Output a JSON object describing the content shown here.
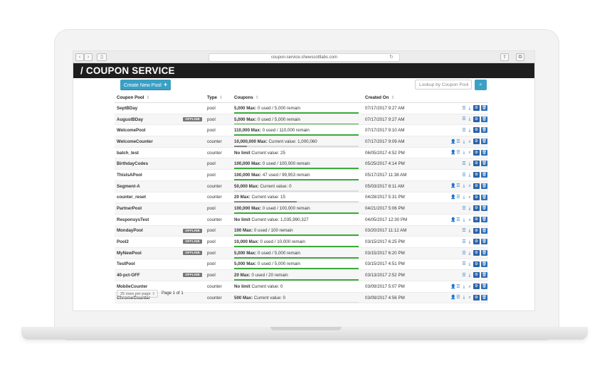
{
  "browser": {
    "url": "coupon-service.shewscottlabs.com",
    "back": "‹",
    "forward": "›",
    "sidebar_icon": "▯",
    "reload_icon": "↻",
    "share_icon": "⇧",
    "tabs_icon": "⧉"
  },
  "header": {
    "title": "/ COUPON SERVICE"
  },
  "toolbar": {
    "create_label": "Create New Pool",
    "create_icon": "+",
    "lookup_placeholder": "Lookup by Coupon Pool",
    "search_icon": "⌕"
  },
  "columns": {
    "name": "Coupon Pool",
    "type": "Type",
    "coupons": "Coupons",
    "created": "Created On",
    "sort_icon": "⇕"
  },
  "rows": [
    {
      "name": "SeptBDay",
      "badge": "",
      "type": "pool",
      "max": "5,000 Max:",
      "detail": "0 used / 5,000 remain",
      "progress": 1.0,
      "bar": "green",
      "created": "07/17/2017 9:27 AM",
      "user_icon": false
    },
    {
      "name": "AugustBDay",
      "badge": "OFFLINE",
      "type": "pool",
      "max": "5,000 Max:",
      "detail": "0 used / 5,000 remain",
      "progress": 1.0,
      "bar": "green",
      "created": "07/17/2017 9:27 AM",
      "user_icon": false
    },
    {
      "name": "WelcomePool",
      "badge": "",
      "type": "pool",
      "max": "110,000 Max:",
      "detail": "0 used / 110,000 remain",
      "progress": 1.0,
      "bar": "green",
      "created": "07/17/2017 9:10 AM",
      "user_icon": false
    },
    {
      "name": "WelcomeCounter",
      "badge": "",
      "type": "counter",
      "max": "10,000,000 Max:",
      "detail": "Current value: 1,000,060",
      "progress": 0.1,
      "bar": "dark",
      "created": "07/17/2017 9:09 AM",
      "user_icon": true
    },
    {
      "name": "batch_test",
      "badge": "",
      "type": "counter",
      "max": "No limit",
      "detail": "Current value: 25",
      "progress": null,
      "bar": "none",
      "created": "06/05/2017 4:52 PM",
      "user_icon": true
    },
    {
      "name": "BirthdayCodes",
      "badge": "",
      "type": "pool",
      "max": "100,000 Max:",
      "detail": "0 used / 100,000 remain",
      "progress": 1.0,
      "bar": "green",
      "created": "05/25/2017 4:14 PM",
      "user_icon": false
    },
    {
      "name": "ThisIsAPool",
      "badge": "",
      "type": "pool",
      "max": "100,000 Max:",
      "detail": "47 used / 99,953 remain",
      "progress": 1.0,
      "bar": "green",
      "created": "05/17/2017 11:38 AM",
      "user_icon": false
    },
    {
      "name": "Segment-A",
      "badge": "",
      "type": "counter",
      "max": "50,000 Max:",
      "detail": "Current value: 0",
      "progress": 0.0,
      "bar": "dark",
      "created": "05/03/2017 8:11 AM",
      "user_icon": true
    },
    {
      "name": "counter_reset",
      "badge": "",
      "type": "counter",
      "max": "20 Max:",
      "detail": "Current value: 15",
      "progress": 0.5,
      "bar": "dark",
      "created": "04/28/2017 5:31 PM",
      "user_icon": true
    },
    {
      "name": "PartnerPool",
      "badge": "",
      "type": "pool",
      "max": "100,000 Max:",
      "detail": "0 used / 100,000 remain",
      "progress": 1.0,
      "bar": "green",
      "created": "04/21/2017 5:06 PM",
      "user_icon": false
    },
    {
      "name": "ResponsysTest",
      "badge": "",
      "type": "counter",
      "max": "No limit",
      "detail": "Current value: 1,035,990,327",
      "progress": null,
      "bar": "none",
      "created": "04/05/2017 12:30 PM",
      "user_icon": true
    },
    {
      "name": "MondayPool",
      "badge": "OFFLINE",
      "type": "pool",
      "max": "100 Max:",
      "detail": "0 used / 100 remain",
      "progress": 1.0,
      "bar": "green",
      "created": "03/20/2017 11:12 AM",
      "user_icon": false
    },
    {
      "name": "Pool2",
      "badge": "OFFLINE",
      "type": "pool",
      "max": "10,000 Max:",
      "detail": "0 used / 10,000 remain",
      "progress": 1.0,
      "bar": "green",
      "created": "03/15/2017 6:25 PM",
      "user_icon": false
    },
    {
      "name": "MyNewPool",
      "badge": "OFFLINE",
      "type": "pool",
      "max": "5,000 Max:",
      "detail": "0 used / 5,000 remain",
      "progress": 1.0,
      "bar": "green",
      "created": "03/15/2017 6:20 PM",
      "user_icon": false
    },
    {
      "name": "TestPool",
      "badge": "",
      "type": "pool",
      "max": "5,000 Max:",
      "detail": "0 used / 5,000 remain",
      "progress": 1.0,
      "bar": "green",
      "created": "03/15/2017 4:51 PM",
      "user_icon": false
    },
    {
      "name": "40-pct-OFF",
      "badge": "OFFLINE",
      "type": "pool",
      "max": "20 Max:",
      "detail": "0 used / 20 remain",
      "progress": 1.0,
      "bar": "green",
      "created": "03/13/2017 2:52 PM",
      "user_icon": false
    },
    {
      "name": "MobileCounter",
      "badge": "",
      "type": "counter",
      "max": "No limit",
      "detail": "Current value: 0",
      "progress": null,
      "bar": "none",
      "created": "03/09/2017 5:07 PM",
      "user_icon": true
    },
    {
      "name": "ChromeCounter",
      "badge": "",
      "type": "counter",
      "max": "500 Max:",
      "detail": "Current value: 0",
      "progress": 0.0,
      "bar": "dark",
      "created": "03/09/2017 4:56 PM",
      "user_icon": true
    }
  ],
  "action_icons": {
    "user": "👤",
    "list": "☰",
    "download": "⤓",
    "lookup": "⌕",
    "edit": "⚙",
    "delete": "🗑"
  },
  "footer": {
    "rows_per_page": "25 rows per page",
    "caret": "⇕",
    "page_label": "Page 1 of 1"
  },
  "colors": {
    "accent": "#3aa0c4",
    "header_bg": "#1e1e1e",
    "progress_green": "#3cab3c",
    "action_blue": "#2a63a8"
  }
}
